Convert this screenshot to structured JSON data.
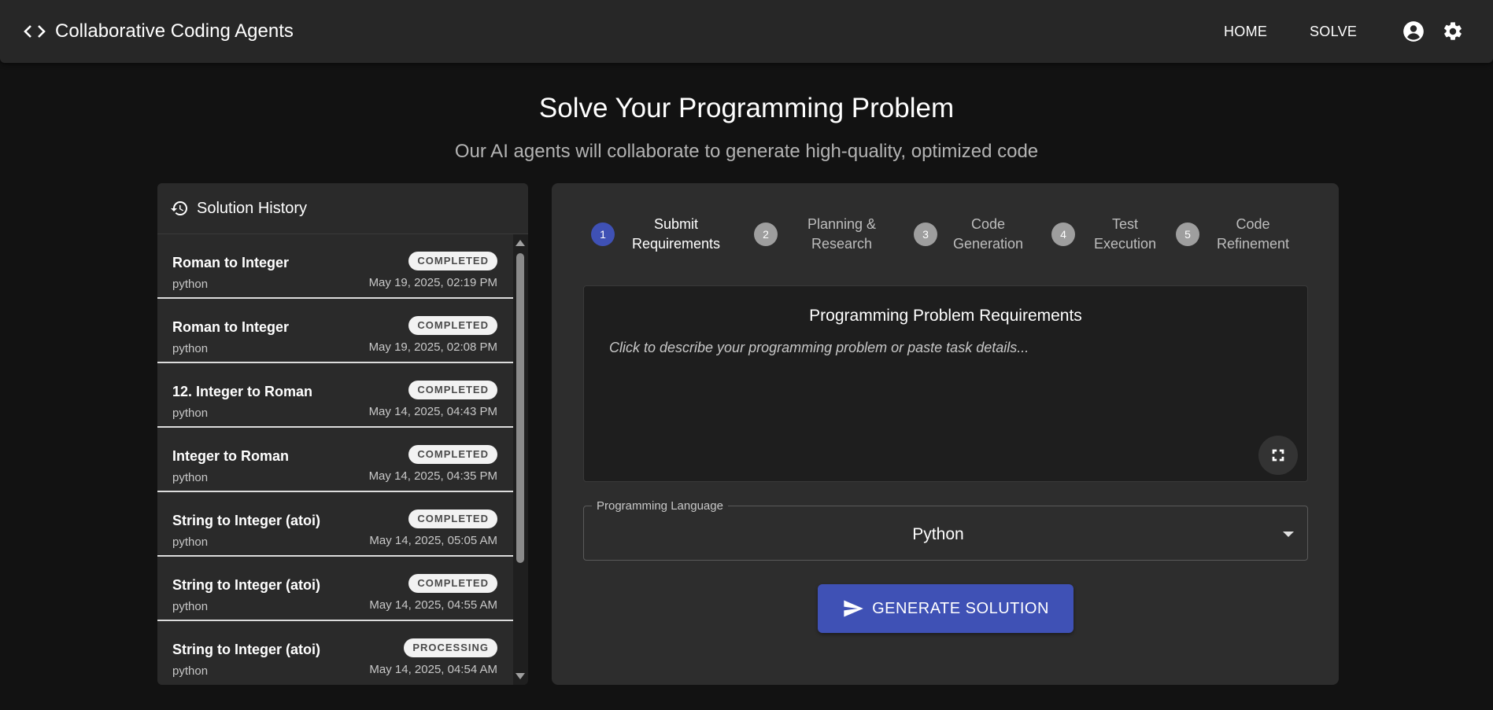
{
  "header": {
    "brand_icon": "code-icon",
    "title": "Collaborative Coding Agents",
    "nav": [
      {
        "label": "HOME"
      },
      {
        "label": "SOLVE"
      }
    ],
    "account_icon": "account-circle-icon",
    "settings_icon": "gear-icon"
  },
  "page": {
    "title": "Solve Your Programming Problem",
    "subtitle": "Our AI agents will collaborate to generate high-quality, optimized code"
  },
  "history": {
    "icon": "history-icon",
    "title": "Solution History",
    "items": [
      {
        "name": "Roman to Integer",
        "lang": "python",
        "status": "COMPLETED",
        "date": "May 19, 2025, 02:19 PM"
      },
      {
        "name": "Roman to Integer",
        "lang": "python",
        "status": "COMPLETED",
        "date": "May 19, 2025, 02:08 PM"
      },
      {
        "name": "12. Integer to Roman",
        "lang": "python",
        "status": "COMPLETED",
        "date": "May 14, 2025, 04:43 PM"
      },
      {
        "name": "Integer to Roman",
        "lang": "python",
        "status": "COMPLETED",
        "date": "May 14, 2025, 04:35 PM"
      },
      {
        "name": "String to Integer (atoi)",
        "lang": "python",
        "status": "COMPLETED",
        "date": "May 14, 2025, 05:05 AM"
      },
      {
        "name": "String to Integer (atoi)",
        "lang": "python",
        "status": "COMPLETED",
        "date": "May 14, 2025, 04:55 AM"
      },
      {
        "name": "String to Integer (atoi)",
        "lang": "python",
        "status": "PROCESSING",
        "date": "May 14, 2025, 04:54 AM"
      }
    ]
  },
  "stepper": {
    "active_step": 1,
    "steps": [
      {
        "num": "1",
        "line1": "Submit",
        "line2": "Requirements"
      },
      {
        "num": "2",
        "line1": "Planning &",
        "line2": "Research"
      },
      {
        "num": "3",
        "line1": "Code",
        "line2": "Generation"
      },
      {
        "num": "4",
        "line1": "Test",
        "line2": "Execution"
      },
      {
        "num": "5",
        "line1": "Code",
        "line2": "Refinement"
      }
    ]
  },
  "requirements": {
    "title": "Programming Problem Requirements",
    "placeholder": "Click to describe your programming problem or paste task details...",
    "expand_icon": "fullscreen-icon"
  },
  "language": {
    "label": "Programming Language",
    "value": "Python"
  },
  "generate": {
    "label": "GENERATE SOLUTION",
    "icon": "send-icon"
  },
  "colors": {
    "background": "#121212",
    "appbar": "#272727",
    "accent": "#3f51b5",
    "panel": "#2d2d2d"
  }
}
